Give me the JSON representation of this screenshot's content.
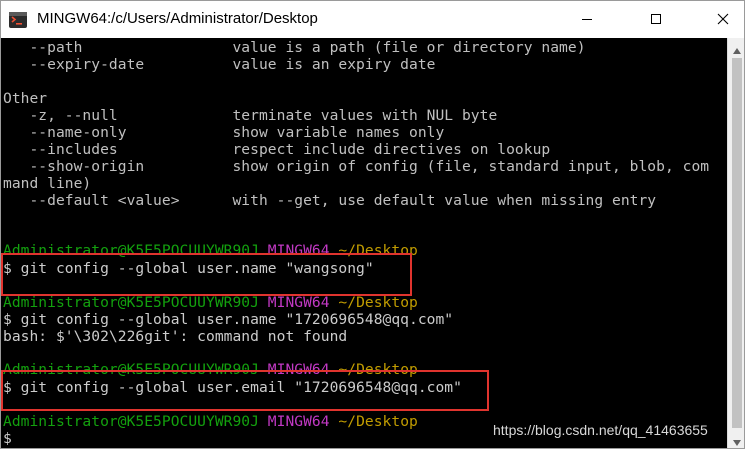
{
  "window": {
    "title": "MINGW64:/c/Users/Administrator/Desktop",
    "icon": "git-bash-icon",
    "controls": {
      "minimize": "minimize-icon",
      "maximize": "maximize-icon",
      "close": "close-icon"
    }
  },
  "colors": {
    "terminal_bg": "#000000",
    "default_text": "#c0c0c0",
    "prompt_user": "#13a10e",
    "prompt_shell": "#c239c4",
    "prompt_path": "#c19c00",
    "highlight_box": "#e0342e"
  },
  "terminal": {
    "help_lines": [
      "   --path                 value is a path (file or directory name)",
      "   --expiry-date          value is an expiry date",
      "",
      "Other",
      "   -z, --null             terminate values with NUL byte",
      "   --name-only            show variable names only",
      "   --includes             respect include directives on lookup",
      "   --show-origin          show origin of config (file, standard input, blob, com",
      "mand line)",
      "   --default <value>      with --get, use default value when missing entry"
    ],
    "sessions": [
      {
        "prompt_user": "Administrator@K5E5POCUUYWR90J",
        "prompt_shell": "MINGW64",
        "prompt_path": "~/Desktop",
        "command": "$ git config --global user.name \"wangsong\"",
        "output": ""
      },
      {
        "prompt_user": "Administrator@K5E5POCUUYWR90J",
        "prompt_shell": "MINGW64",
        "prompt_path": "~/Desktop",
        "command": "$ git config --global user.name \"1720696548@qq.com\"",
        "output": "bash: $'\\302\\226git': command not found"
      },
      {
        "prompt_user": "Administrator@K5E5POCUUYWR90J",
        "prompt_shell": "MINGW64",
        "prompt_path": "~/Desktop",
        "command": "$ git config --global user.email \"1720696548@qq.com\"",
        "output": ""
      },
      {
        "prompt_user": "Administrator@K5E5POCUUYWR90J",
        "prompt_shell": "MINGW64",
        "prompt_path": "~/Desktop",
        "command": "$",
        "output": ""
      }
    ]
  },
  "watermark": "https://blog.csdn.net/qq_41463655"
}
